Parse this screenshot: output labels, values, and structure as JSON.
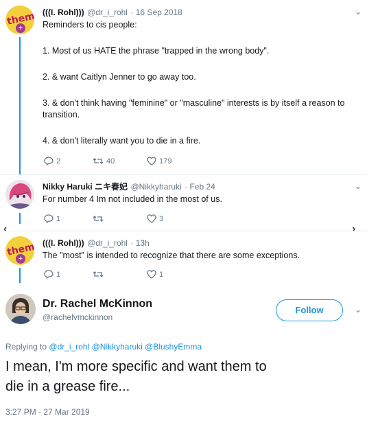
{
  "tweet1": {
    "name": "(((I. Rohl)))",
    "handle": "@dr_i_rohl",
    "date": "· 16 Sep 2018",
    "avatar_text": "them!",
    "lines": [
      "Reminders to cis people:",
      "1. Most of us HATE the phrase \"trapped in the wrong body\".",
      "2. & want Caitlyn Jenner to go away too.",
      "3. & don't think having \"feminine\" or \"masculine\" interests is by itself a reason to",
      "transition.",
      "4. & don't literally want you to die in a fire."
    ],
    "replies": "2",
    "retweets": "40",
    "likes": "179"
  },
  "tweet2": {
    "name": "Nikky Haruki ニキ春妃",
    "handle": "@Nikkyharuki",
    "date": "· Feb 24",
    "text": "For number 4 Im not included in the most of us.",
    "replies": "1",
    "retweets": "",
    "likes": "3"
  },
  "tweet3": {
    "name": "(((I. Rohl)))",
    "handle": "@dr_i_rohl",
    "date": "· 13h",
    "avatar_text": "them!",
    "text": "The \"most\" is intended to recognize that there are some exceptions.",
    "replies": "1",
    "retweets": "",
    "likes": "1"
  },
  "main": {
    "name": "Dr. Rachel McKinnon",
    "handle": "@rachelvmckinnon",
    "follow_label": "Follow",
    "replying_prefix": "Replying to",
    "replying_handles": [
      "@dr_i_rohl",
      "@Nikkyharuki",
      "@BlushyEmma"
    ],
    "text_line1": "I mean, I'm more specific and want them to",
    "text_line2": "die in a grease fire...",
    "timestamp": "3:27 PM - 27 Mar 2019"
  },
  "colors": {
    "accent": "#1b95e0",
    "muted": "#657786",
    "text": "#14171a"
  },
  "icons": [
    "reply-icon",
    "retweet-icon",
    "like-icon",
    "chevron-down-icon",
    "nav-left-icon",
    "nav-right-icon"
  ]
}
